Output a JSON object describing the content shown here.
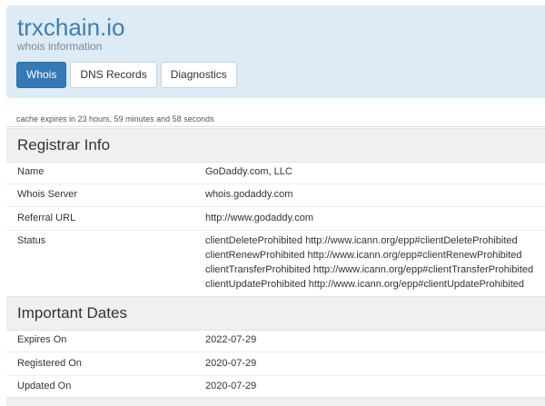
{
  "header": {
    "domain": "trxchain.io",
    "subtitle": "whois information",
    "tabs": [
      {
        "label": "Whois",
        "active": true
      },
      {
        "label": "DNS Records",
        "active": false
      },
      {
        "label": "Diagnostics",
        "active": false
      }
    ]
  },
  "cache_notice": "cache expires in 23 hours, 59 minutes and 58 seconds",
  "registrar": {
    "title": "Registrar Info",
    "rows": [
      {
        "label": "Name",
        "value": "GoDaddy.com, LLC"
      },
      {
        "label": "Whois Server",
        "value": "whois.godaddy.com"
      },
      {
        "label": "Referral URL",
        "value": "http://www.godaddy.com"
      }
    ],
    "status": {
      "label": "Status",
      "lines": [
        "clientDeleteProhibited http://www.icann.org/epp#clientDeleteProhibited",
        "clientRenewProhibited http://www.icann.org/epp#clientRenewProhibited",
        "clientTransferProhibited http://www.icann.org/epp#clientTransferProhibited",
        "clientUpdateProhibited http://www.icann.org/epp#clientUpdateProhibited"
      ]
    }
  },
  "dates": {
    "title": "Important Dates",
    "rows": [
      {
        "label": "Expires On",
        "value": "2022-07-29"
      },
      {
        "label": "Registered On",
        "value": "2020-07-29"
      },
      {
        "label": "Updated On",
        "value": "2020-07-29"
      }
    ]
  },
  "colors": {
    "header_bg": "#dcebf6",
    "title_blue": "#3f7fb0",
    "active_tab": "#347ab7"
  }
}
